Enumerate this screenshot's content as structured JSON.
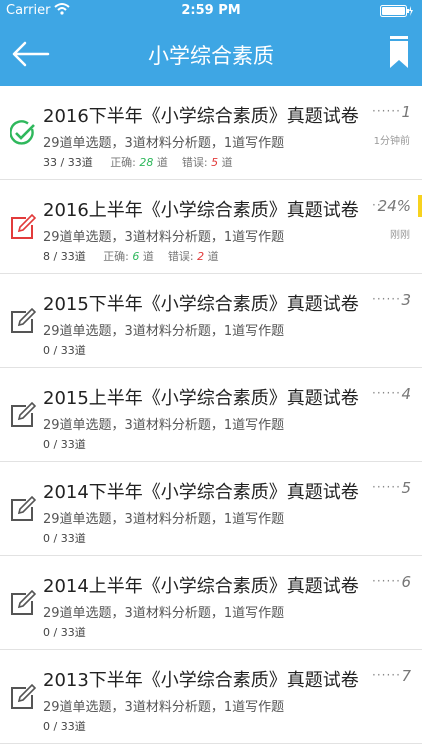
{
  "status": {
    "carrier": "Carrier",
    "time": "2:59 PM"
  },
  "nav": {
    "title": "小学综合素质"
  },
  "items": [
    {
      "title": "2016下半年《小学综合素质》真题试卷",
      "dots": "······",
      "rank": "1",
      "time": "1分钟前",
      "sub": "29道单选题，3道材料分析题，1道写作题",
      "progress": "33 / 33道",
      "correct_label": "正确:",
      "correct": "28",
      "correct_unit": "道",
      "wrong_label": "错误:",
      "wrong": "5",
      "wrong_unit": "道",
      "state": "done"
    },
    {
      "title": "2016上半年《小学综合素质》真题试卷",
      "dots": "··",
      "rank": "24%",
      "time": "刚刚",
      "sub": "29道单选题，3道材料分析题，1道写作题",
      "progress": "8 / 33道",
      "correct_label": "正确:",
      "correct": "6",
      "correct_unit": "道",
      "wrong_label": "错误:",
      "wrong": "2",
      "wrong_unit": "道",
      "state": "inprogress"
    },
    {
      "title": "2015下半年《小学综合素质》真题试卷",
      "dots": "······",
      "rank": "3",
      "time": "",
      "sub": "29道单选题，3道材料分析题，1道写作题",
      "progress": "0 / 33道",
      "state": "new"
    },
    {
      "title": "2015上半年《小学综合素质》真题试卷",
      "dots": "······",
      "rank": "4",
      "time": "",
      "sub": "29道单选题，3道材料分析题，1道写作题",
      "progress": "0 / 33道",
      "state": "new"
    },
    {
      "title": "2014下半年《小学综合素质》真题试卷",
      "dots": "······",
      "rank": "5",
      "time": "",
      "sub": "29道单选题，3道材料分析题，1道写作题",
      "progress": "0 / 33道",
      "state": "new"
    },
    {
      "title": "2014上半年《小学综合素质》真题试卷",
      "dots": "······",
      "rank": "6",
      "time": "",
      "sub": "29道单选题，3道材料分析题，1道写作题",
      "progress": "0 / 33道",
      "state": "new"
    },
    {
      "title": "2013下半年《小学综合素质》真题试卷",
      "dots": "······",
      "rank": "7",
      "time": "",
      "sub": "29道单选题，3道材料分析题，1道写作题",
      "progress": "0 / 33道",
      "state": "new"
    }
  ]
}
